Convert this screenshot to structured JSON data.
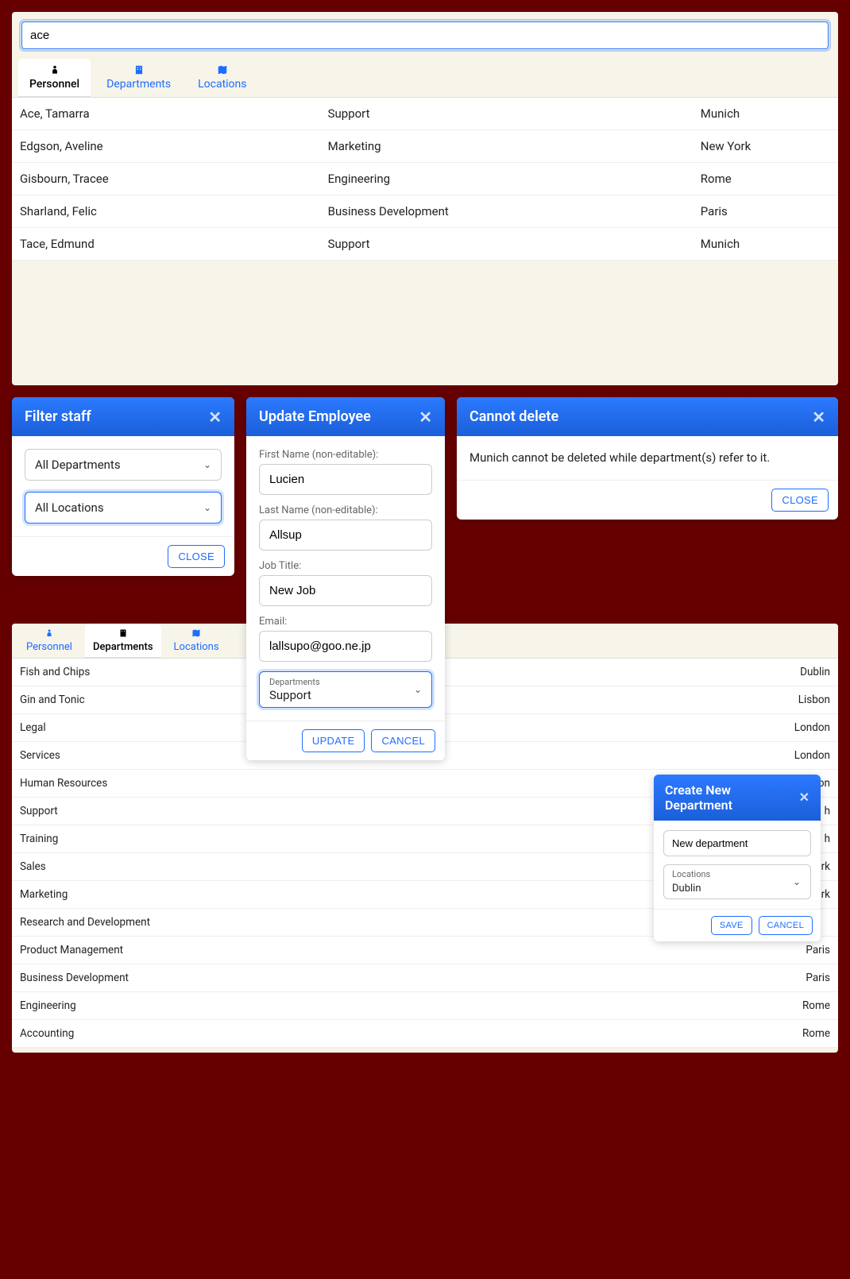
{
  "search": {
    "value": "ace"
  },
  "tabs": {
    "personnel": "Personnel",
    "departments": "Departments",
    "locations": "Locations"
  },
  "personnel_rows": [
    {
      "name": "Ace, Tamarra",
      "dept": "Support",
      "loc": "Munich"
    },
    {
      "name": "Edgson, Aveline",
      "dept": "Marketing",
      "loc": "New York"
    },
    {
      "name": "Gisbourn, Tracee",
      "dept": "Engineering",
      "loc": "Rome"
    },
    {
      "name": "Sharland, Felic",
      "dept": "Business Development",
      "loc": "Paris"
    },
    {
      "name": "Tace, Edmund",
      "dept": "Support",
      "loc": "Munich"
    }
  ],
  "filter_modal": {
    "title": "Filter staff",
    "dept_value": "All Departments",
    "loc_value": "All Locations",
    "close": "CLOSE"
  },
  "update_modal": {
    "title": "Update Employee",
    "first_label": "First Name (non-editable):",
    "first_value": "Lucien",
    "last_label": "Last Name (non-editable):",
    "last_value": "Allsup",
    "job_label": "Job Title:",
    "job_value": "New Job",
    "email_label": "Email:",
    "email_value": "lallsupo@goo.ne.jp",
    "dept_mini_label": "Departments",
    "dept_value": "Support",
    "update_btn": "UPDATE",
    "cancel_btn": "CANCEL"
  },
  "error_modal": {
    "title": "Cannot delete",
    "body": "Munich cannot be deleted while department(s) refer to it.",
    "close": "CLOSE"
  },
  "dept_rows": [
    {
      "name": "Fish and Chips",
      "loc": "Dublin"
    },
    {
      "name": "Gin and Tonic",
      "loc": "Lisbon"
    },
    {
      "name": "Legal",
      "loc": "London"
    },
    {
      "name": "Services",
      "loc": "London"
    },
    {
      "name": "Human Resources",
      "loc": "on"
    },
    {
      "name": "Support",
      "loc": "h"
    },
    {
      "name": "Training",
      "loc": "h"
    },
    {
      "name": "Sales",
      "loc": "York"
    },
    {
      "name": "Marketing",
      "loc": "York"
    },
    {
      "name": "Research and Development",
      "loc": ""
    },
    {
      "name": "Product Management",
      "loc": "Paris"
    },
    {
      "name": "Business Development",
      "loc": "Paris"
    },
    {
      "name": "Engineering",
      "loc": "Rome"
    },
    {
      "name": "Accounting",
      "loc": "Rome"
    }
  ],
  "create_modal": {
    "title": "Create New Department",
    "name_value": "New department",
    "loc_mini_label": "Locations",
    "loc_value": "Dublin",
    "save": "SAVE",
    "cancel": "CANCEL"
  }
}
